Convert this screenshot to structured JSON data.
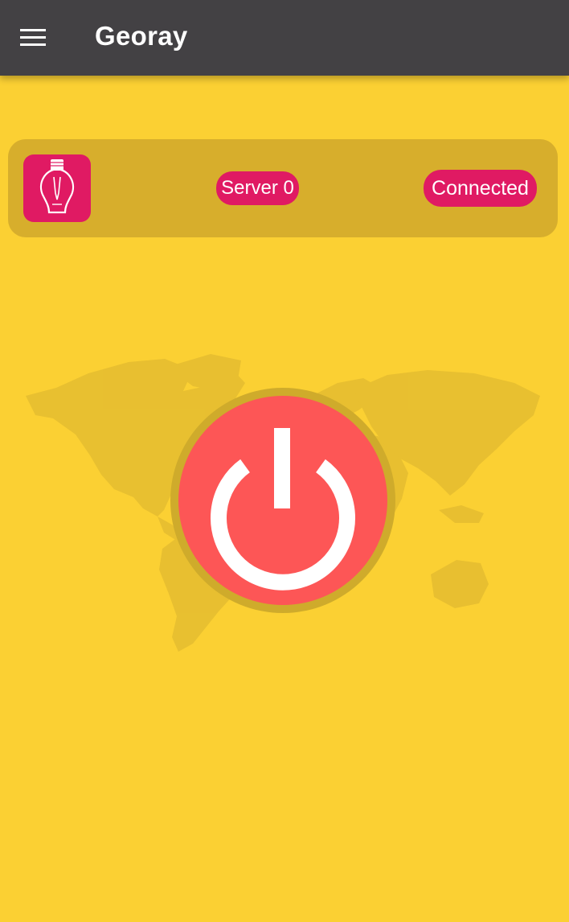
{
  "app_bar": {
    "title": "Georay",
    "menu_icon": "hamburger-menu-icon",
    "background_color": "#434144"
  },
  "server_card": {
    "icon": "lightbulb-icon",
    "server_label": "Server 0",
    "status_label": "Connected",
    "accent_color": "#E01A63"
  },
  "power_button": {
    "icon": "power-icon",
    "color": "#FD5656"
  },
  "background": {
    "color": "#FBD033",
    "decoration": "world-map"
  }
}
